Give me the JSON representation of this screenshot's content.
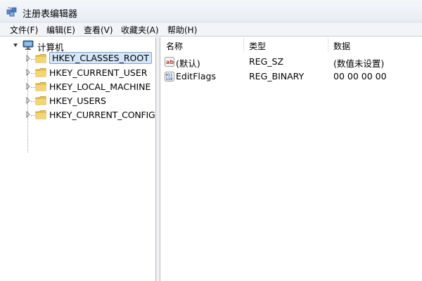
{
  "window": {
    "title": "注册表编辑器",
    "icon": "registry-editor-icon"
  },
  "menu": [
    {
      "label": "文件(F)"
    },
    {
      "label": "编辑(E)"
    },
    {
      "label": "查看(V)"
    },
    {
      "label": "收藏夹(A)"
    },
    {
      "label": "帮助(H)"
    }
  ],
  "tree": {
    "root": {
      "label": "计算机",
      "icon": "computer-icon"
    },
    "keys": [
      {
        "label": "HKEY_CLASSES_ROOT",
        "selected": true
      },
      {
        "label": "HKEY_CURRENT_USER",
        "selected": false
      },
      {
        "label": "HKEY_LOCAL_MACHINE",
        "selected": false
      },
      {
        "label": "HKEY_USERS",
        "selected": false
      },
      {
        "label": "HKEY_CURRENT_CONFIG",
        "selected": false
      }
    ]
  },
  "list": {
    "columns": [
      "名称",
      "类型",
      "数据"
    ],
    "rows": [
      {
        "icon": "string-value-icon",
        "name": "(默认)",
        "type": "REG_SZ",
        "data": "(数值未设置)"
      },
      {
        "icon": "binary-value-icon",
        "name": "EditFlags",
        "type": "REG_BINARY",
        "data": "00 00 00 00"
      }
    ]
  },
  "colors": {
    "selection": "#d5e6f8",
    "selection_border": "#7da2ce",
    "folder": "#e8c04e"
  }
}
